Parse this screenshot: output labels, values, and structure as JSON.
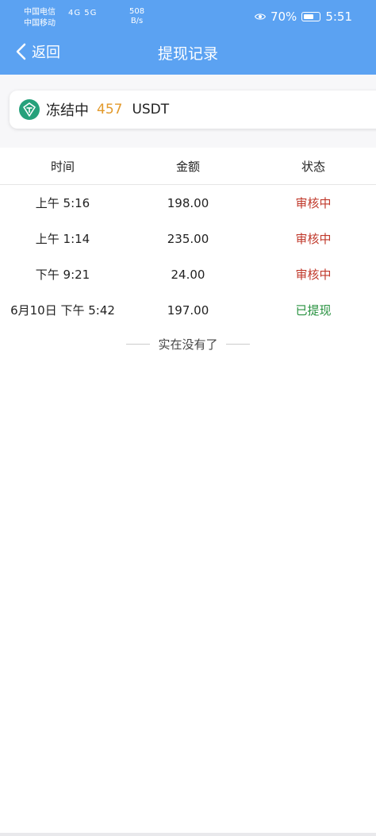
{
  "status_bar": {
    "carrier1": "中国电信",
    "carrier2": "中国移动",
    "signal_labels": "4G 5G",
    "speed_value": "508",
    "speed_unit": "B/s",
    "battery": "70%",
    "battery_level": 0.7,
    "time": "5:51"
  },
  "nav": {
    "back_label": "返回",
    "title": "提现记录"
  },
  "balance": {
    "label": "冻结中",
    "value": "457",
    "unit": "USDT"
  },
  "table": {
    "headers": [
      "时间",
      "金额",
      "状态"
    ],
    "rows": [
      {
        "time": "上午 5:16",
        "amount": "198.00",
        "status": "审核中",
        "state": "pending"
      },
      {
        "time": "上午 1:14",
        "amount": "235.00",
        "status": "审核中",
        "state": "pending"
      },
      {
        "time": "下午 9:21",
        "amount": "24.00",
        "status": "审核中",
        "state": "pending"
      },
      {
        "time": "6月10日 下午 5:42",
        "amount": "197.00",
        "status": "已提现",
        "state": "done"
      }
    ],
    "end_text": "实在没有了"
  },
  "colors": {
    "header": "#5ba2f2",
    "accent_amount": "#e39a2c",
    "pending": "#c0392b",
    "done": "#27913f"
  },
  "icons": {
    "back": "chevron-left-icon",
    "eye": "eye-icon",
    "battery": "battery-icon",
    "usdt": "usdt-icon"
  }
}
